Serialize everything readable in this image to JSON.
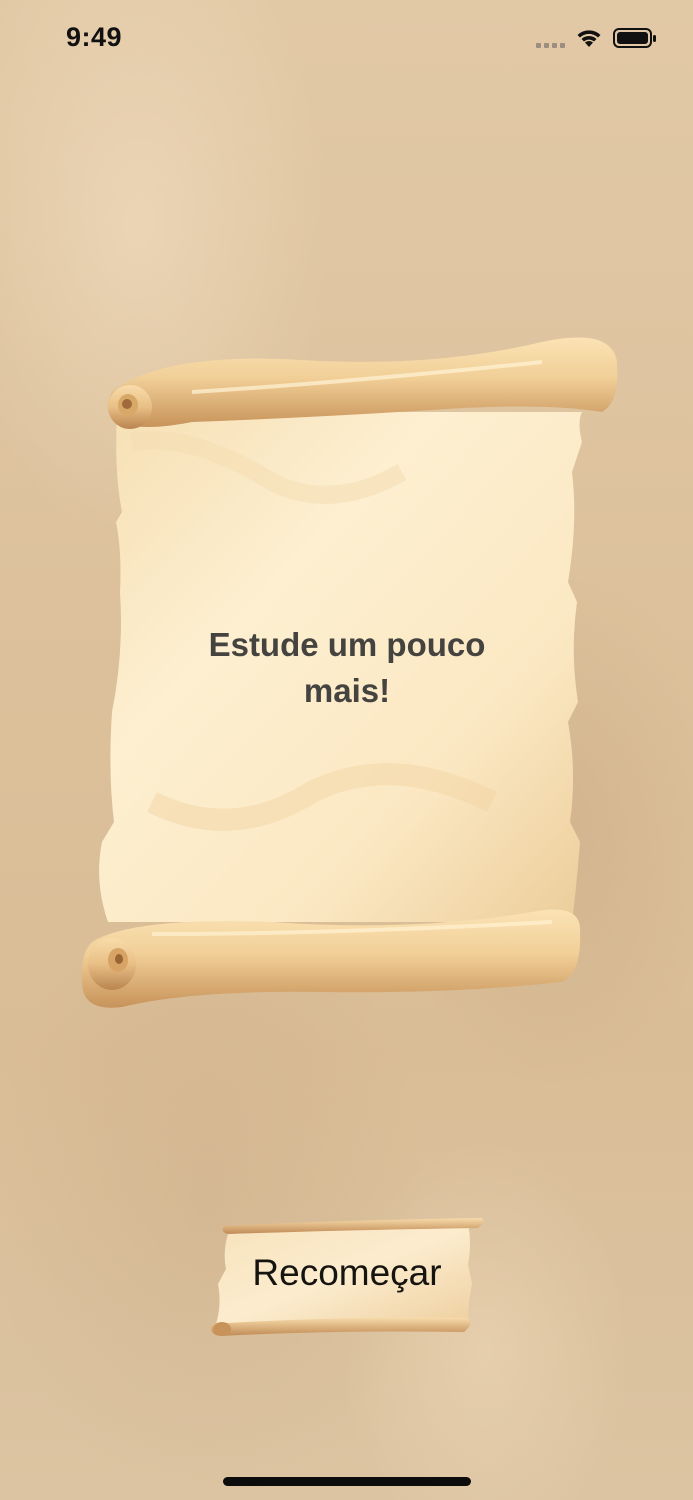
{
  "status_bar": {
    "time": "9:49",
    "icons": [
      "signal-icon",
      "wifi-icon",
      "battery-icon"
    ]
  },
  "scroll": {
    "message": "Estude um pouco mais!"
  },
  "restart_button": {
    "label": "Recomeçar"
  },
  "colors": {
    "background": "#dcc19c",
    "parchment": "#fbe9c6",
    "roll": "#e9c48e",
    "text": "#45433f"
  }
}
